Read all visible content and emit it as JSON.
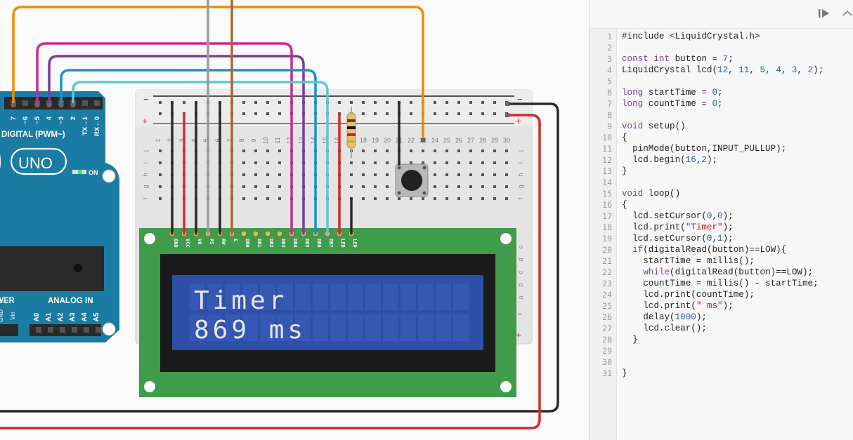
{
  "editor": {
    "toolbar": {
      "step_icon": "step-forward-icon",
      "collapse_icon": "chevron-up-icon"
    },
    "lines": [
      "#include <LiquidCrystal.h>",
      "",
      "const int button = 7;",
      "LiquidCrystal lcd(12, 11, 5, 4, 3, 2);",
      "",
      "long startTime = 0;",
      "long countTime = 0;",
      "",
      "void setup()",
      "{",
      "  pinMode(button,INPUT_PULLUP);",
      "  lcd.begin(16,2);",
      "}",
      "",
      "void loop()",
      "{",
      "  lcd.setCursor(0,0);",
      "  lcd.print(\"Timer\");",
      "  lcd.setCursor(0,1);",
      "  if(digitalRead(button)==LOW){",
      "    startTime = millis();",
      "    while(digitalRead(button)==LOW);",
      "    countTime = millis() - startTime;",
      "    lcd.print(countTime);",
      "    lcd.print(\" ms\");",
      "    delay(1000);",
      "    lcd.clear();",
      "  }",
      "",
      "",
      "}"
    ]
  },
  "arduino": {
    "digital_label": "DIGITAL (PWM~)",
    "model": "UNO",
    "on_label": "ON",
    "power_label": "WER",
    "analog_label": "ANALOG IN",
    "digital_pins": [
      "7",
      "~6",
      "~5",
      "4",
      "~3",
      "2",
      "TX→1",
      "RX←0"
    ],
    "analog_pins": [
      "A0",
      "A1",
      "A2",
      "A3",
      "A4",
      "A5"
    ],
    "power_pins": [
      "GND",
      "Vin"
    ]
  },
  "lcd": {
    "line1": "Timer",
    "line2": "869 ms",
    "pin_labels": [
      "GND",
      "VCC",
      "V0",
      "RS",
      "RW",
      "E",
      "DB0",
      "DB1",
      "DB2",
      "DB3",
      "DB4",
      "DB5",
      "DB6",
      "DB7",
      "LED",
      "LED"
    ],
    "colors": {
      "board": "#3e9c4b",
      "screen": "#2d4fa8",
      "text": "#e6e6f0"
    }
  },
  "breadboard": {
    "column_numbers": [
      "1",
      "2",
      "3",
      "4",
      "5",
      "6",
      "7",
      "8",
      "9",
      "10",
      "11",
      "12",
      "13",
      "14",
      "15",
      "16",
      "17",
      "18",
      "19",
      "20",
      "21",
      "22",
      "23",
      "24",
      "25",
      "26",
      "27",
      "28",
      "29",
      "30"
    ],
    "rows_top": [
      "j",
      "i",
      "h",
      "g",
      "f"
    ],
    "rows_bottom": [
      "e",
      "d",
      "c",
      "b",
      "a"
    ],
    "rail_minus": "−",
    "rail_plus": "+"
  },
  "wire_colors": {
    "orange": "#f08a00",
    "magenta": "#c62b95",
    "purple": "#7d3a9b",
    "blue": "#1a93c6",
    "lightblue": "#5ec6d9",
    "gray": "#9a9a9a",
    "brown": "#a8672d",
    "black": "#2a2a2a",
    "red": "#d62a2a"
  }
}
